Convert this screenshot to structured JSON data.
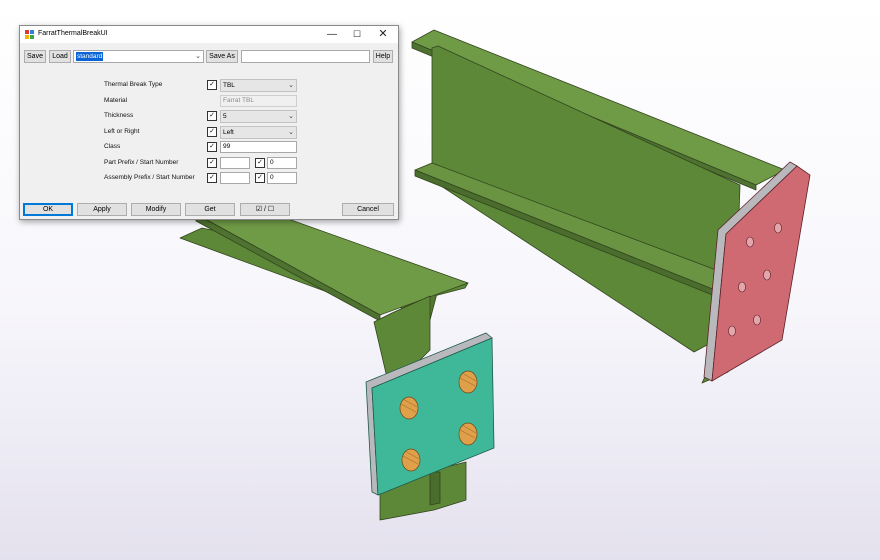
{
  "window": {
    "title": "FarratThermalBreakUI",
    "controls": {
      "minimize": "—",
      "maximize": "☐",
      "close": "✕"
    }
  },
  "toolbar": {
    "save_label": "Save",
    "load_label": "Load",
    "preset_value": "standard",
    "save_as_label": "Save As",
    "save_as_name": "",
    "help_label": "Help"
  },
  "form": {
    "thermal_break_type": {
      "label": "Thermal Break Type",
      "value": "TBL",
      "checked": true
    },
    "material": {
      "label": "Material",
      "value": "Farrat TBL"
    },
    "thickness": {
      "label": "Thickness",
      "value": "5",
      "checked": true
    },
    "left_or_right": {
      "label": "Left or Right",
      "value": "Left",
      "checked": true
    },
    "class": {
      "label": "Class",
      "value": "99",
      "checked": true
    },
    "part_prefix": {
      "label": "Part Prefix / Start Number",
      "prefix": "",
      "start": "0",
      "checked": true
    },
    "assembly_prefix": {
      "label": "Assembly Prefix / Start Number",
      "prefix": "",
      "start": "0",
      "checked": true
    }
  },
  "footer": {
    "ok_label": "OK",
    "apply_label": "Apply",
    "modify_label": "Modify",
    "get_label": "Get",
    "toggle_label": "☑ / ☐",
    "cancel_label": "Cancel"
  },
  "scene": {
    "beam_color": "#5f8b3d",
    "plate_color_front": "#3fb89a",
    "plate_color_back": "#d06a72",
    "hole_color": "#e0a04a",
    "checkbox_glyph": "✓",
    "dropdown_arrow": "⌄"
  }
}
